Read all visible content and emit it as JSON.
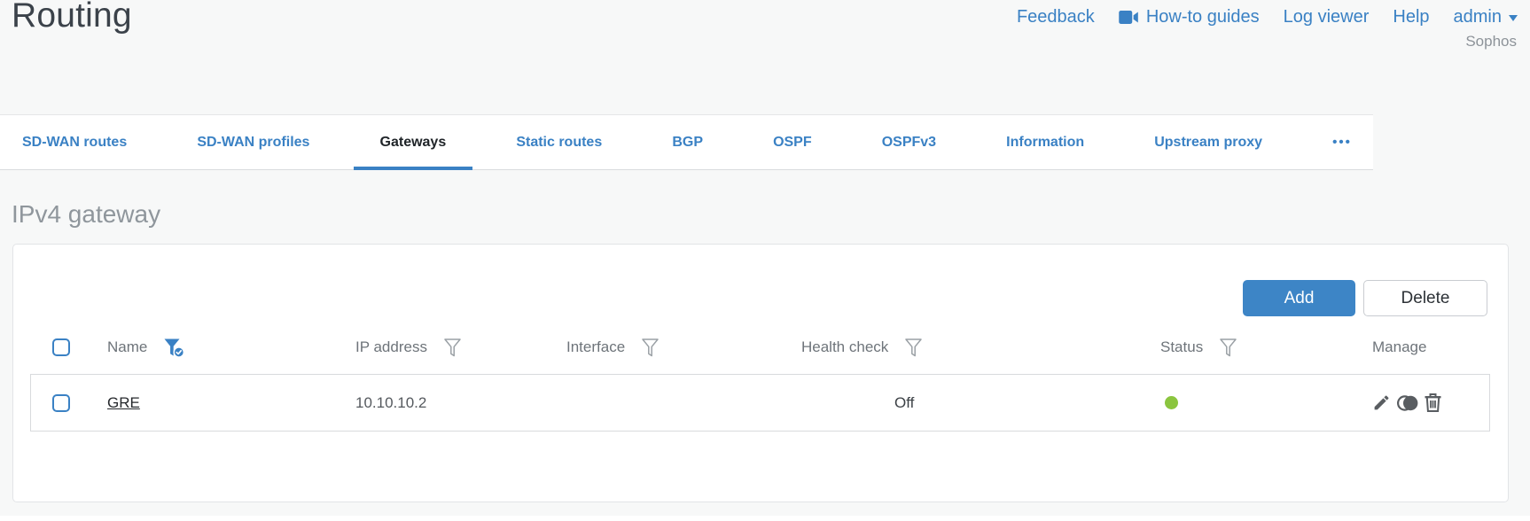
{
  "header": {
    "title": "Routing",
    "nav": {
      "feedback": "Feedback",
      "howto_guides": "How-to guides",
      "log_viewer": "Log viewer",
      "help": "Help",
      "user": "admin",
      "brand": "Sophos"
    }
  },
  "tabs": {
    "items": [
      {
        "label": "SD-WAN routes",
        "active": false
      },
      {
        "label": "SD-WAN profiles",
        "active": false
      },
      {
        "label": "Gateways",
        "active": true
      },
      {
        "label": "Static routes",
        "active": false
      },
      {
        "label": "BGP",
        "active": false
      },
      {
        "label": "OSPF",
        "active": false
      },
      {
        "label": "OSPFv3",
        "active": false
      },
      {
        "label": "Information",
        "active": false
      },
      {
        "label": "Upstream proxy",
        "active": false
      }
    ],
    "overflow": "•••"
  },
  "section": {
    "title": "IPv4 gateway"
  },
  "toolbar": {
    "add_label": "Add",
    "delete_label": "Delete"
  },
  "table": {
    "columns": [
      {
        "label": "Name",
        "filter": "active"
      },
      {
        "label": "IP address",
        "filter": "default"
      },
      {
        "label": "Interface",
        "filter": "default"
      },
      {
        "label": "Health check",
        "filter": "default"
      },
      {
        "label": "Status",
        "filter": "default"
      },
      {
        "label": "Manage",
        "filter": "none"
      }
    ],
    "rows": [
      {
        "name": "GRE",
        "ip_address": "10.10.10.2",
        "interface": "",
        "health_check": "Off",
        "status": "up",
        "manage": [
          "edit",
          "clone",
          "delete"
        ]
      }
    ]
  },
  "colors": {
    "accent_blue": "#3a81c4",
    "add_button_blue": "#3d85c6",
    "status_green": "#8bc53f",
    "title_dark": "#3b424a",
    "section_gray": "#8f969c",
    "icon_gray": "#595d61"
  }
}
